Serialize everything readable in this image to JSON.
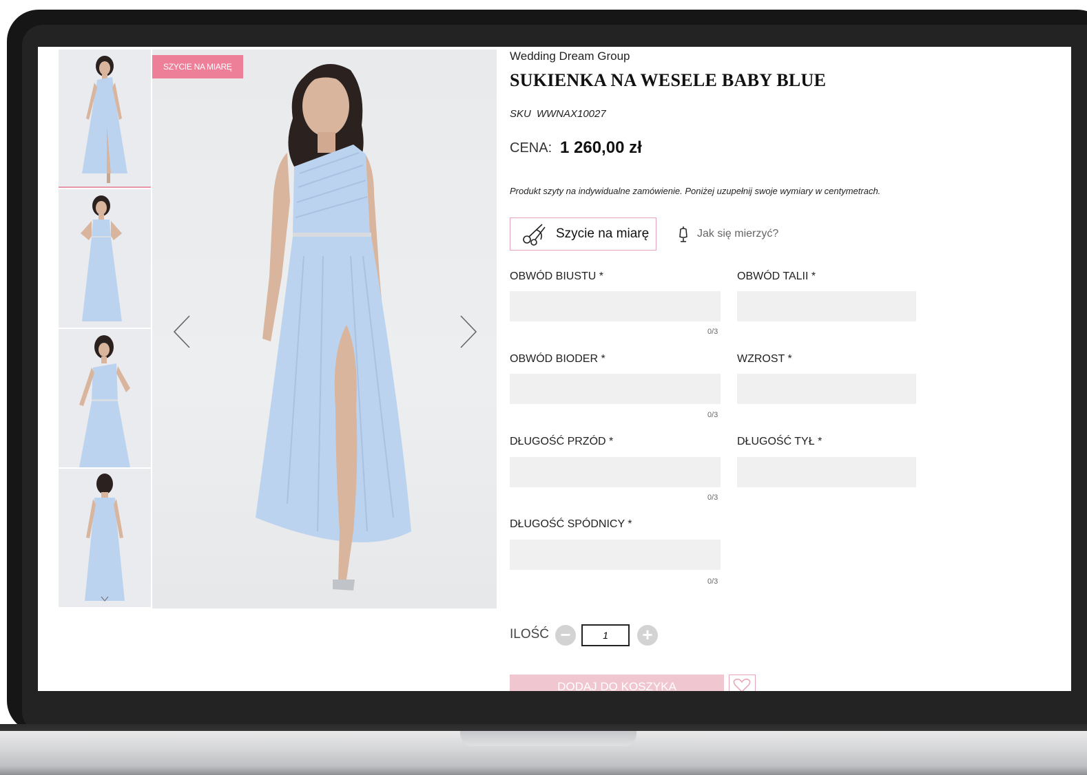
{
  "product": {
    "brand": "Wedding Dream Group",
    "title": "SUKIENKA NA WESELE BABY BLUE",
    "sku_label": "SKU",
    "sku_value": "WWNAX10027",
    "price_label": "CENA:",
    "price_value": "1 260,00 zł",
    "note": "Produkt szyty na indywidualne zamówienie. Poniżej uzupełnij swoje wymiary w centymetrach.",
    "badge": "SZYCIE NA MIARĘ",
    "dress_color": "#bcd3ef"
  },
  "options": {
    "tailor_label": "Szycie na miarę",
    "measure_link": "Jak się mierzyć?"
  },
  "fields": {
    "bust": {
      "label": "OBWÓD BIUSTU *",
      "counter": "0/3"
    },
    "waist": {
      "label": "OBWÓD TALII *"
    },
    "hips": {
      "label": "OBWÓD BIODER *",
      "counter": "0/3"
    },
    "height": {
      "label": "WZROST *"
    },
    "front_length": {
      "label": "DŁUGOŚĆ PRZÓD *",
      "counter": "0/3"
    },
    "back_length": {
      "label": "DŁUGOŚĆ TYŁ *"
    },
    "skirt_length": {
      "label": "DŁUGOŚĆ SPÓDNICY *",
      "counter": "0/3"
    }
  },
  "quantity": {
    "label": "ILOŚĆ",
    "value": "1",
    "minus": "−",
    "plus": "+"
  },
  "cart": {
    "add_label": "DODAJ DO KOSZYKA"
  },
  "colors": {
    "accent_pink": "#ee7f98",
    "input_bg": "#f0f0f0"
  }
}
